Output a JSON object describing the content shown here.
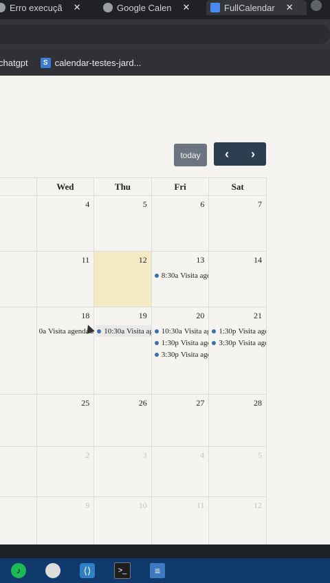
{
  "browser": {
    "tabs": [
      {
        "label": "Erro execuçã",
        "close": "✕"
      },
      {
        "label": "Google Calen",
        "close": "✕"
      },
      {
        "label": "FullCalendar",
        "close": "✕"
      }
    ],
    "bookmarks": [
      {
        "label": "chatgpt"
      },
      {
        "label": "calendar-testes-jard...",
        "icon_text": "S"
      }
    ]
  },
  "toolbar": {
    "today_label": "today",
    "prev_label": "‹",
    "next_label": "›"
  },
  "calendar": {
    "headers": [
      "",
      "Wed",
      "Thu",
      "Fri",
      "Sat"
    ],
    "weeks": [
      {
        "height": 80,
        "days": [
          {
            "num": "",
            "events": []
          },
          {
            "num": "4",
            "events": []
          },
          {
            "num": "5",
            "events": []
          },
          {
            "num": "6",
            "events": []
          },
          {
            "num": "7",
            "events": []
          }
        ]
      },
      {
        "height": 80,
        "days": [
          {
            "num": "",
            "events": []
          },
          {
            "num": "11",
            "events": []
          },
          {
            "num": "12",
            "today": true,
            "events": []
          },
          {
            "num": "13",
            "events": [
              {
                "time": "8:30a",
                "title": "Visita agendada"
              }
            ]
          },
          {
            "num": "14",
            "events": []
          }
        ]
      },
      {
        "height": 126,
        "days": [
          {
            "num": "",
            "events": []
          },
          {
            "num": "18",
            "events": [
              {
                "time": "0a",
                "title": "Visita agendada",
                "nodot": true
              }
            ]
          },
          {
            "num": "19",
            "events": [
              {
                "time": "10:30a",
                "title": "Visita agendada",
                "highlight": true
              }
            ]
          },
          {
            "num": "20",
            "events": [
              {
                "time": "10:30a",
                "title": "Visita agendada"
              },
              {
                "time": "1:30p",
                "title": "Visita agendada"
              },
              {
                "time": "3:30p",
                "title": "Visita agendada"
              }
            ]
          },
          {
            "num": "21",
            "events": [
              {
                "time": "1:30p",
                "title": "Visita agendada"
              },
              {
                "time": "3:30p",
                "title": "Visita agendada"
              }
            ]
          }
        ]
      },
      {
        "height": 75,
        "days": [
          {
            "num": "",
            "events": []
          },
          {
            "num": "25",
            "events": []
          },
          {
            "num": "26",
            "events": []
          },
          {
            "num": "27",
            "events": []
          },
          {
            "num": "28",
            "events": []
          }
        ]
      },
      {
        "height": 72,
        "days": [
          {
            "num": "",
            "other": true,
            "events": []
          },
          {
            "num": "2",
            "other": true,
            "events": []
          },
          {
            "num": "3",
            "other": true,
            "events": []
          },
          {
            "num": "4",
            "other": true,
            "events": []
          },
          {
            "num": "5",
            "other": true,
            "events": []
          }
        ]
      },
      {
        "height": 75,
        "days": [
          {
            "num": "",
            "other": true,
            "events": []
          },
          {
            "num": "9",
            "other": true,
            "events": []
          },
          {
            "num": "10",
            "other": true,
            "events": []
          },
          {
            "num": "11",
            "other": true,
            "events": []
          },
          {
            "num": "12",
            "other": true,
            "events": []
          }
        ]
      }
    ]
  },
  "taskbar": {
    "icons": [
      "spotify-icon",
      "chrome-icon",
      "vscode-icon",
      "terminal-icon",
      "document-icon"
    ]
  }
}
